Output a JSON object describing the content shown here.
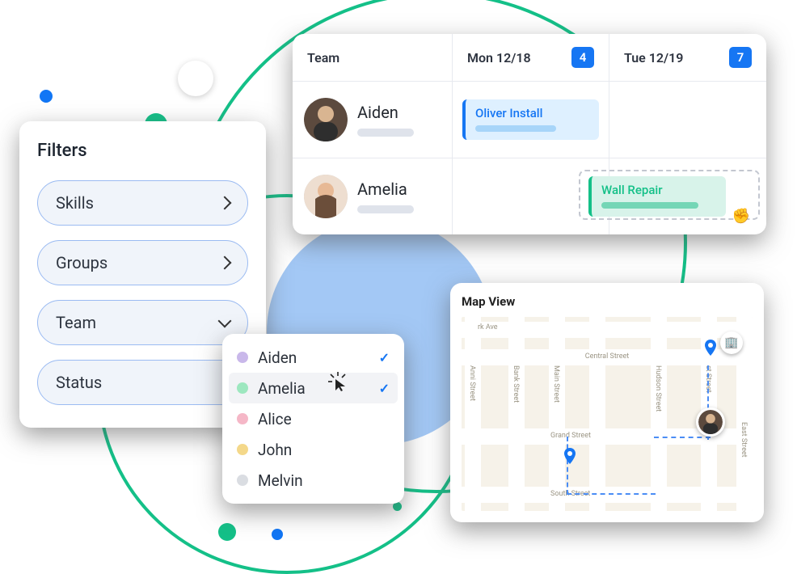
{
  "filters": {
    "title": "Filters",
    "items": [
      {
        "label": "Skills",
        "open": false
      },
      {
        "label": "Groups",
        "open": false
      },
      {
        "label": "Team",
        "open": true
      },
      {
        "label": "Status",
        "open": false
      }
    ]
  },
  "teamDropdown": {
    "items": [
      {
        "label": "Aiden",
        "color": "#c9b8ea",
        "checked": true,
        "selected": false
      },
      {
        "label": "Amelia",
        "color": "#9de7bf",
        "checked": true,
        "selected": true
      },
      {
        "label": "Alice",
        "color": "#f5b7c7",
        "checked": false,
        "selected": false
      },
      {
        "label": "John",
        "color": "#f4d88a",
        "checked": false,
        "selected": false
      },
      {
        "label": "Melvin",
        "color": "#dadde2",
        "checked": false,
        "selected": false
      }
    ]
  },
  "schedule": {
    "teamHeader": "Team",
    "days": [
      {
        "label": "Mon 12/18",
        "count": "4"
      },
      {
        "label": "Tue 12/19",
        "count": "7"
      }
    ],
    "rows": [
      {
        "name": "Aiden",
        "tasks": [
          {
            "title": "Oliver Install",
            "style": "blue"
          },
          null
        ]
      },
      {
        "name": "Amelia",
        "tasks": [
          null,
          {
            "title": "Wall Repair",
            "style": "green"
          }
        ]
      }
    ]
  },
  "map": {
    "title": "Map View",
    "streets": {
      "h": [
        "rk Ave",
        "Central Street",
        "Grand Street",
        "South Street"
      ],
      "v": [
        "Anni Street",
        "Bank Street",
        "Main Street",
        "Hudson Street",
        "st Street",
        "East Street"
      ]
    }
  }
}
